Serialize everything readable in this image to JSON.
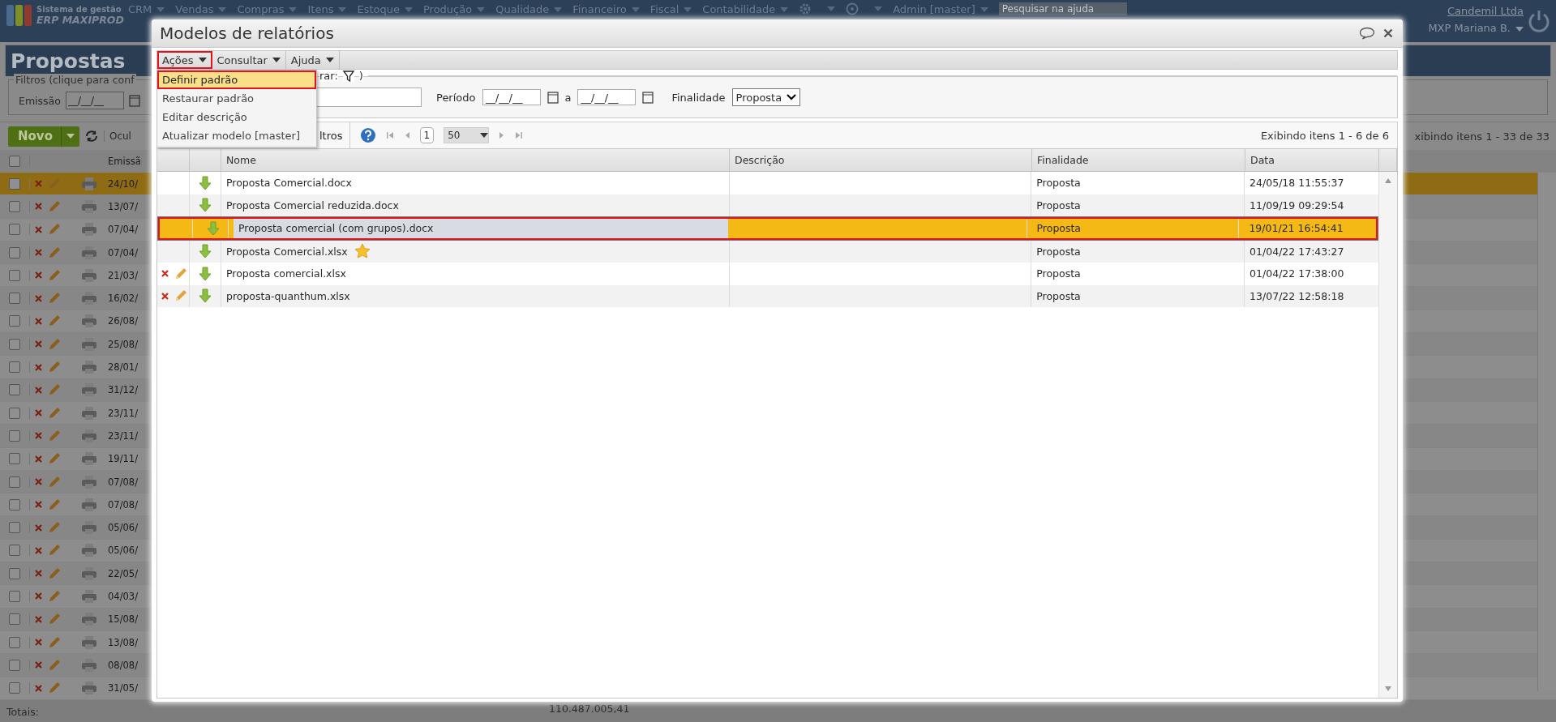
{
  "topbar": {
    "logo_line1": "Sistema de gestão",
    "logo_line2": "ERP MAXIPROD",
    "menu": [
      "CRM",
      "Vendas",
      "Compras",
      "Itens",
      "Estoque",
      "Produção",
      "Qualidade",
      "Financeiro",
      "Fiscal",
      "Contabilidade"
    ],
    "admin": "Admin [master]",
    "search": {
      "placeholder": "Pesquisar na ajuda"
    },
    "company": "Candemil Ltda",
    "user": "MXP Mariana B."
  },
  "page": {
    "title": "Propostas",
    "filters_legend": "Filtros (clique para conf",
    "emissao_label": "Emissão",
    "date_placeholder": "__/__/__",
    "new_button": "Novo",
    "hide_label": "Ocul",
    "column": "Emissã",
    "all_checked": false,
    "count": "xibindo itens 1 - 33 de 33",
    "rows": [
      {
        "date": "24/10/",
        "selected": true,
        "checked": false
      },
      {
        "date": "13/07/",
        "selected": false,
        "checked": false
      },
      {
        "date": "07/04/",
        "selected": false,
        "checked": false
      },
      {
        "date": "07/04/",
        "selected": false,
        "checked": false
      },
      {
        "date": "21/03/",
        "selected": false,
        "checked": false
      },
      {
        "date": "16/02/",
        "selected": false,
        "checked": false
      },
      {
        "date": "26/08/",
        "selected": false,
        "checked": false
      },
      {
        "date": "25/08/",
        "selected": false,
        "checked": false
      },
      {
        "date": "28/01/",
        "selected": false,
        "checked": false
      },
      {
        "date": "31/12/",
        "selected": false,
        "checked": false
      },
      {
        "date": "23/11/",
        "selected": false,
        "checked": false
      },
      {
        "date": "23/11/",
        "selected": false,
        "checked": false
      },
      {
        "date": "19/11/",
        "selected": false,
        "checked": false
      },
      {
        "date": "07/08/",
        "selected": false,
        "checked": false
      },
      {
        "date": "07/08/",
        "selected": false,
        "checked": false
      },
      {
        "date": "05/06/",
        "selected": false,
        "checked": false
      },
      {
        "date": "05/06/",
        "selected": false,
        "checked": false
      },
      {
        "date": "22/05/",
        "selected": false,
        "checked": false
      },
      {
        "date": "04/03/",
        "selected": false,
        "checked": false
      },
      {
        "date": "15/08/",
        "selected": false,
        "checked": false
      },
      {
        "date": "13/08/",
        "selected": false,
        "checked": false
      },
      {
        "date": "08/08/",
        "selected": false,
        "checked": false
      },
      {
        "date": "31/05/",
        "selected": false,
        "checked": false
      }
    ],
    "totals_label": "Totais:",
    "total": "110.487.005,41"
  },
  "dialog": {
    "title": "Modelos de relatórios",
    "menus": [
      {
        "label": "Ações",
        "annotated": true
      },
      {
        "label": "Consultar",
        "annotated": false
      },
      {
        "label": "Ajuda",
        "annotated": false
      }
    ],
    "open_menu": [
      {
        "label": "Definir padrão",
        "hovered": true,
        "annotated": true
      },
      {
        "label": "Restaurar padrão",
        "hovered": false,
        "annotated": false
      },
      {
        "label": "Editar descrição",
        "hovered": false,
        "annotated": false
      },
      {
        "label": "Atualizar modelo [master]",
        "hovered": false,
        "annotated": false
      }
    ],
    "filter_legend": "rar:",
    "filter_legend_end": ")",
    "period_label": "Período",
    "date_placeholder": "__/__/__",
    "to_label": "a",
    "purpose_label": "Finalidade",
    "purpose_value": "Proposta",
    "filters_button": "ltros",
    "page": "1",
    "page_size": "50",
    "count": "Exibindo itens 1 - 6 de 6",
    "columns": [
      "Nome",
      "Descrição",
      "Finalidade",
      "Data"
    ],
    "rows": [
      {
        "name": "Proposta Comercial.docx",
        "purpose": "Proposta",
        "date": "24/05/18 11:55:37",
        "editable": false,
        "default": false,
        "selected": false
      },
      {
        "name": "Proposta Comercial reduzida.docx",
        "purpose": "Proposta",
        "date": "11/09/19 09:29:54",
        "editable": false,
        "default": false,
        "selected": false
      },
      {
        "name": "Proposta comercial (com grupos).docx",
        "purpose": "Proposta",
        "date": "19/01/21 16:54:41",
        "editable": false,
        "default": false,
        "selected": true
      },
      {
        "name": "Proposta Comercial.xlsx",
        "purpose": "Proposta",
        "date": "01/04/22 17:43:27",
        "editable": false,
        "default": true,
        "selected": false
      },
      {
        "name": "Proposta comercial.xlsx",
        "purpose": "Proposta",
        "date": "01/04/22 17:38:00",
        "editable": true,
        "default": false,
        "selected": false
      },
      {
        "name": "proposta-quanthum.xlsx",
        "purpose": "Proposta",
        "date": "13/07/22 12:58:18",
        "editable": true,
        "default": false,
        "selected": false
      }
    ]
  }
}
